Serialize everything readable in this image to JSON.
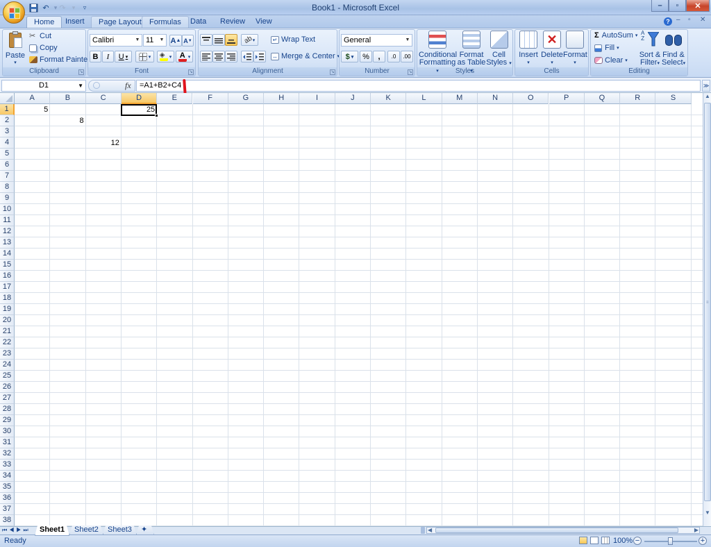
{
  "app": {
    "title": "Book1 - Microsoft Excel",
    "accent": "#15428b",
    "selection_color": "#f7c867"
  },
  "quick_access": [
    {
      "name": "save-icon",
      "glyph": "▣"
    },
    {
      "name": "undo-icon",
      "glyph": "↶"
    },
    {
      "name": "redo-icon",
      "glyph": "↷"
    }
  ],
  "window_controls": {
    "minimize": "–",
    "restore": "▫",
    "close": "✕"
  },
  "tabs": [
    "Home",
    "Insert",
    "Page Layout",
    "Formulas",
    "Data",
    "Review",
    "View"
  ],
  "active_tab": "Home",
  "ribbon": {
    "clipboard": {
      "label": "Clipboard",
      "paste": "Paste",
      "cut": "Cut",
      "copy": "Copy",
      "format_painter": "Format Painter"
    },
    "font": {
      "label": "Font",
      "font_name": "Calibri",
      "font_size": "11",
      "grow": "A",
      "shrink": "A",
      "bold": "B",
      "italic": "I",
      "underline": "U",
      "font_color_letter": "A"
    },
    "alignment": {
      "label": "Alignment",
      "wrap_text": "Wrap Text",
      "merge_center": "Merge & Center"
    },
    "number": {
      "label": "Number",
      "format": "General",
      "currency": "$",
      "percent": "%",
      "comma": ",",
      "inc_decimal": ".0",
      "dec_decimal": ".00"
    },
    "styles": {
      "label": "Styles",
      "conditional_1": "Conditional",
      "conditional_2": "Formatting",
      "format_table_1": "Format",
      "format_table_2": "as Table",
      "cell_styles_1": "Cell",
      "cell_styles_2": "Styles"
    },
    "cells": {
      "label": "Cells",
      "insert": "Insert",
      "delete": "Delete",
      "format": "Format"
    },
    "editing": {
      "label": "Editing",
      "autosum": "AutoSum",
      "fill": "Fill",
      "clear": "Clear",
      "sort_1": "Sort &",
      "sort_2": "Filter",
      "find_1": "Find &",
      "find_2": "Select"
    }
  },
  "formula_bar": {
    "name_box": "D1",
    "fx": "fx",
    "formula": "=A1+B2+C4"
  },
  "sheet": {
    "columns": [
      "A",
      "B",
      "C",
      "D",
      "E",
      "F",
      "G",
      "H",
      "I",
      "J",
      "K",
      "L",
      "M",
      "N",
      "O",
      "P",
      "Q",
      "R",
      "S"
    ],
    "selected_column": "D",
    "selected_row": 1,
    "row_count": 38,
    "cells": [
      {
        "ref": "A1",
        "value": "5"
      },
      {
        "ref": "B2",
        "value": "8"
      },
      {
        "ref": "C4",
        "value": "12"
      },
      {
        "ref": "D1",
        "value": "25"
      }
    ]
  },
  "sheet_tabs": [
    "Sheet1",
    "Sheet2",
    "Sheet3"
  ],
  "active_sheet": "Sheet1",
  "status": {
    "text": "Ready",
    "zoom": "100%"
  }
}
